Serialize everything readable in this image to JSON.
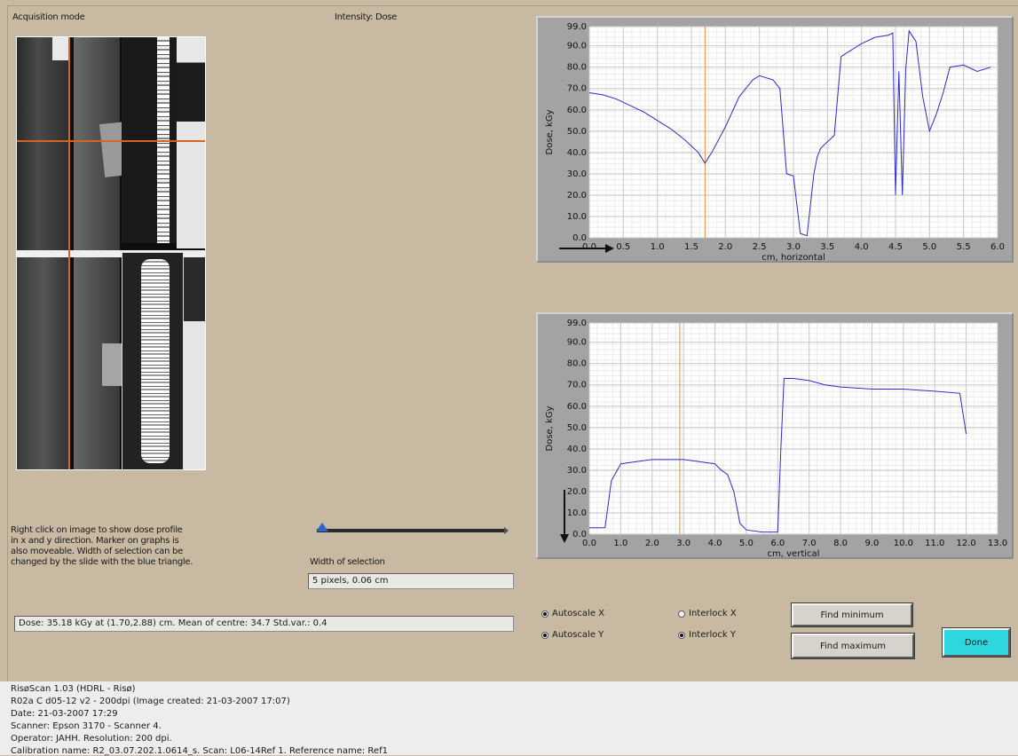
{
  "header": {
    "mode_label": "Acquisition mode",
    "intensity_label": "Intensity: Dose"
  },
  "help_text": [
    "Right click on image to show dose profile",
    "in x and y direction. Marker on graphs is",
    "also moveable. Width of selection can be",
    "changed by the slide with the blue triangle."
  ],
  "selection": {
    "label": "Width of selection",
    "value": "5 pixels, 0.06 cm",
    "slider_fraction": 0.03
  },
  "dose_readout": "Dose: 35.18 kGy at (1.70,2.88) cm. Mean of centre: 34.7  Std.var.: 0.4",
  "options": {
    "autoscale_x": {
      "label": "Autoscale X",
      "checked": true
    },
    "autoscale_y": {
      "label": "Autoscale Y",
      "checked": true
    },
    "interlock_x": {
      "label": "Interlock X",
      "checked": false
    },
    "interlock_y": {
      "label": "Interlock Y",
      "checked": true
    }
  },
  "buttons": {
    "find_minimum": "Find minimum",
    "find_maximum": "Find maximum",
    "done": "Done"
  },
  "status_lines": [
    "RisøScan 1.03 (HDRL - Risø)",
    "R02a C d05-12 v2 - 200dpi (Image created: 21-03-2007 17:07)",
    "Date: 21-03-2007 17:29",
    "Scanner: Epson 3170 - Scanner 4.",
    "Operator: JAHH. Resolution: 200 dpi.",
    "Calibration name: R2_03.07.202.1.0614_s. Scan: L06-14Ref 1. Reference name: Ref1"
  ],
  "colors": {
    "panel_bg": "#c8b9a3",
    "plot_line": "#2b2bd6",
    "marker": "#f08a2c",
    "done_button": "#2ed6e0"
  },
  "chart_data": [
    {
      "type": "line",
      "xlabel": "cm, horizontal",
      "ylabel": "Dose, kGy",
      "xlim": [
        0,
        6.0
      ],
      "ylim": [
        0,
        99.0
      ],
      "x_ticks": [
        "0.0",
        "0.5",
        "1.0",
        "1.5",
        "2.0",
        "2.5",
        "3.0",
        "3.5",
        "4.0",
        "4.5",
        "5.0",
        "5.5",
        "6.0"
      ],
      "y_ticks": [
        "0.0",
        "10.0",
        "20.0",
        "30.0",
        "40.0",
        "50.0",
        "60.0",
        "70.0",
        "80.0",
        "90.0",
        "99.0"
      ],
      "grid": true,
      "marker_x": 1.7,
      "x": [
        0,
        0.2,
        0.4,
        0.6,
        0.8,
        1.0,
        1.2,
        1.4,
        1.6,
        1.7,
        1.8,
        2.0,
        2.2,
        2.4,
        2.5,
        2.6,
        2.7,
        2.8,
        2.9,
        3.0,
        3.1,
        3.2,
        3.3,
        3.35,
        3.4,
        3.5,
        3.6,
        3.7,
        3.8,
        3.9,
        4.0,
        4.2,
        4.4,
        4.46,
        4.5,
        4.55,
        4.6,
        4.65,
        4.7,
        4.8,
        4.9,
        5.0,
        5.1,
        5.2,
        5.3,
        5.5,
        5.7,
        5.9
      ],
      "y": [
        68,
        67,
        65,
        62,
        59,
        55,
        51,
        46,
        40,
        35,
        40,
        52,
        66,
        74,
        76,
        75,
        74,
        70,
        30,
        29,
        2,
        1,
        30,
        38,
        42,
        45,
        48,
        85,
        87,
        89,
        91,
        94,
        95,
        96,
        20,
        78,
        20,
        79,
        97,
        92,
        66,
        50,
        58,
        68,
        80,
        81,
        78,
        80
      ]
    },
    {
      "type": "line",
      "xlabel": "cm, vertical",
      "ylabel": "Dose, kGy",
      "xlim": [
        0,
        13.0
      ],
      "ylim": [
        0,
        99.0
      ],
      "x_ticks": [
        "0.0",
        "1.0",
        "2.0",
        "3.0",
        "4.0",
        "5.0",
        "6.0",
        "7.0",
        "8.0",
        "9.0",
        "10.0",
        "11.0",
        "12.0",
        "13.0"
      ],
      "y_ticks": [
        "0.0",
        "10.0",
        "20.0",
        "30.0",
        "40.0",
        "50.0",
        "60.0",
        "70.0",
        "80.0",
        "90.0",
        "99.0"
      ],
      "grid": true,
      "marker_x": 2.88,
      "x": [
        0,
        0.3,
        0.5,
        0.7,
        1.0,
        1.5,
        2.0,
        3.0,
        3.5,
        4.0,
        4.2,
        4.4,
        4.6,
        4.8,
        5.0,
        5.5,
        6.0,
        6.1,
        6.2,
        6.5,
        7.0,
        7.5,
        8.0,
        9.0,
        10.0,
        11.0,
        11.8,
        12.0
      ],
      "y": [
        3,
        3,
        3,
        25,
        33,
        34,
        35,
        35,
        34,
        33,
        30,
        28,
        20,
        5,
        2,
        1,
        1,
        40,
        73,
        73,
        72,
        70,
        69,
        68,
        68,
        67,
        66,
        47
      ]
    }
  ]
}
